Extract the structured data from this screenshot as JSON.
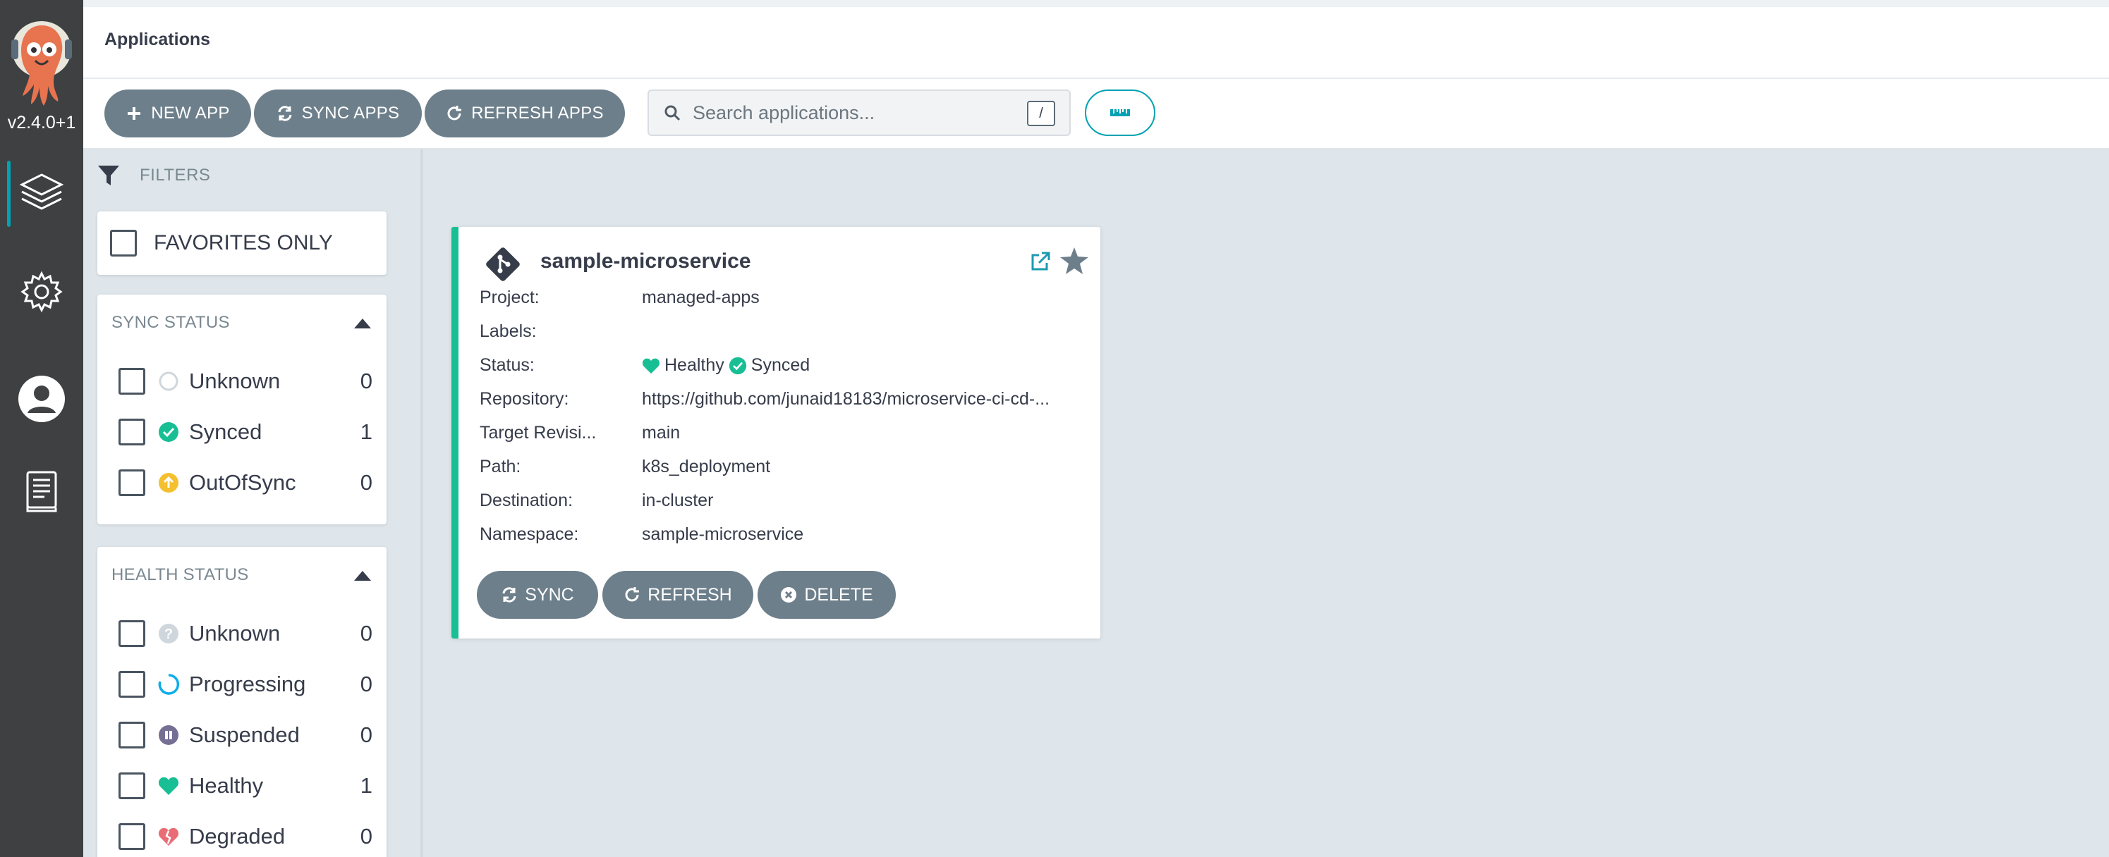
{
  "nav": {
    "version": "v2.4.0+1",
    "items": [
      {
        "name": "applications",
        "icon": "layers-icon"
      },
      {
        "name": "settings",
        "icon": "gear-icon"
      },
      {
        "name": "user-info",
        "icon": "user-icon"
      },
      {
        "name": "documentation",
        "icon": "docs-icon"
      }
    ]
  },
  "header": {
    "title": "Applications"
  },
  "toolbar": {
    "new_app": "NEW APP",
    "sync_apps": "SYNC APPS",
    "refresh_apps": "REFRESH APPS",
    "search_placeholder": "Search applications...",
    "search_shortcut": "/"
  },
  "filters": {
    "title": "FILTERS",
    "favorites_only": "FAVORITES ONLY",
    "sync_status": {
      "title": "SYNC STATUS",
      "items": [
        {
          "label": "Unknown",
          "count": "0"
        },
        {
          "label": "Synced",
          "count": "1"
        },
        {
          "label": "OutOfSync",
          "count": "0"
        }
      ]
    },
    "health_status": {
      "title": "HEALTH STATUS",
      "items": [
        {
          "label": "Unknown",
          "count": "0"
        },
        {
          "label": "Progressing",
          "count": "0"
        },
        {
          "label": "Suspended",
          "count": "0"
        },
        {
          "label": "Healthy",
          "count": "1"
        },
        {
          "label": "Degraded",
          "count": "0"
        }
      ]
    }
  },
  "app": {
    "name": "sample-microservice",
    "fields": [
      {
        "key": "Project:",
        "value": "managed-apps"
      },
      {
        "key": "Labels:",
        "value": ""
      },
      {
        "key": "Status:",
        "health": "Healthy",
        "sync": "Synced"
      },
      {
        "key": "Repository:",
        "value": "https://github.com/junaid18183/microservice-ci-cd-..."
      },
      {
        "key": "Target Revisi...",
        "value": "main"
      },
      {
        "key": "Path:",
        "value": "k8s_deployment"
      },
      {
        "key": "Destination:",
        "value": "in-cluster"
      },
      {
        "key": "Namespace:",
        "value": "sample-microservice"
      }
    ],
    "actions": {
      "sync": "SYNC",
      "refresh": "REFRESH",
      "delete": "DELETE"
    }
  },
  "colors": {
    "accent": "#00a2b3",
    "healthy": "#18be94",
    "out_of_sync": "#f4c030",
    "progressing": "#0dadea",
    "suspended": "#766f94",
    "degraded": "#e96d76",
    "button": "#6d7f8b"
  }
}
